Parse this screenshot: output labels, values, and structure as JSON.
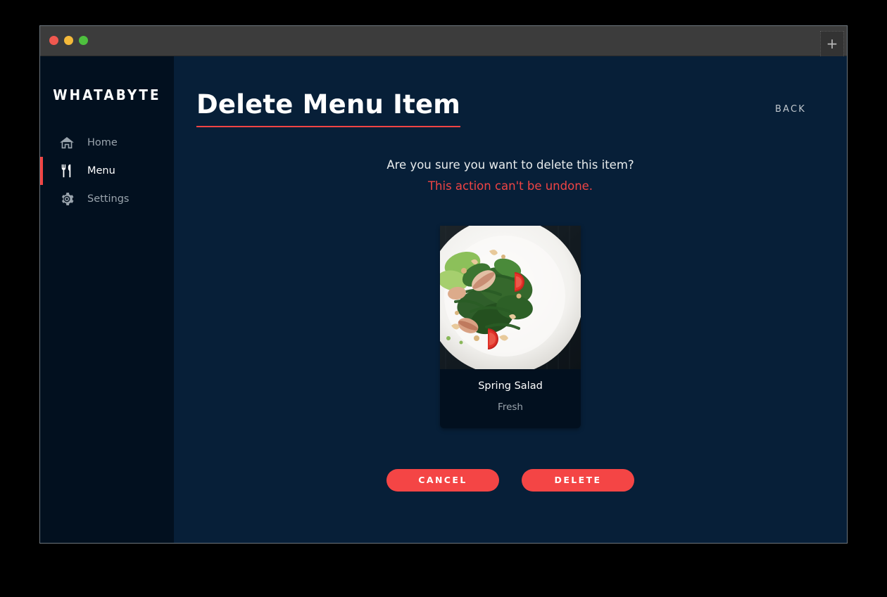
{
  "window": {
    "traffic_lights": [
      {
        "name": "close",
        "color": "#f0584f"
      },
      {
        "name": "minimize",
        "color": "#f4b93a"
      },
      {
        "name": "maximize",
        "color": "#4ec03e"
      }
    ],
    "new_tab_label": "+"
  },
  "sidebar": {
    "brand": "WHATABYTE",
    "items": [
      {
        "label": "Home",
        "icon": "home-icon",
        "active": false
      },
      {
        "label": "Menu",
        "icon": "utensils-icon",
        "active": true
      },
      {
        "label": "Settings",
        "icon": "gear-icon",
        "active": false
      }
    ],
    "active_indicator_color": "#f04444"
  },
  "header": {
    "title": "Delete Menu Item",
    "underline_color": "#f04444",
    "back_label": "BACK"
  },
  "confirm": {
    "question": "Are you sure you want to delete this item?",
    "warning": "This action can't be undone.",
    "warning_color": "#f04444"
  },
  "item": {
    "name": "Spring Salad",
    "description": "Fresh",
    "image_alt": "Spring salad on a white plate with tomato, cashews and greens on a dark wood table"
  },
  "actions": {
    "cancel_label": "CANCEL",
    "delete_label": "DELETE",
    "button_color": "#f44545"
  }
}
